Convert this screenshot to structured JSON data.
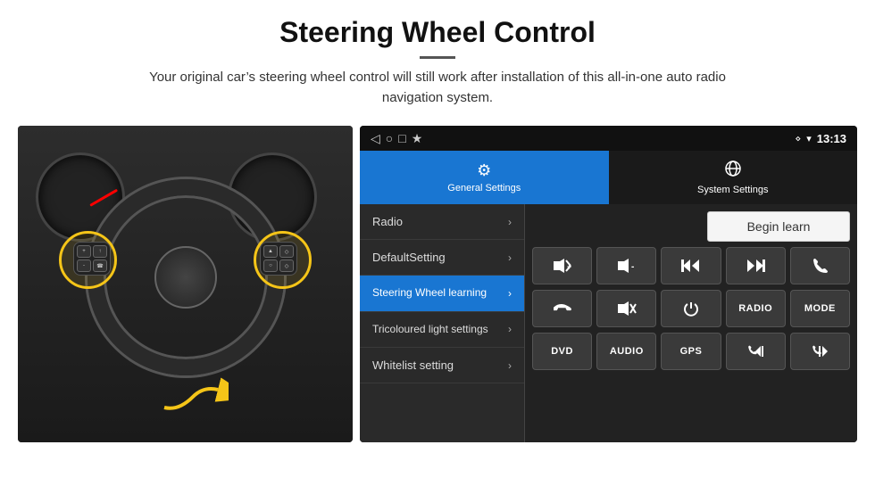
{
  "header": {
    "title": "Steering Wheel Control",
    "divider": true,
    "subtitle": "Your original car’s steering wheel control will still work after installation of this all-in-one auto radio navigation system."
  },
  "headunit": {
    "status_bar": {
      "nav_back": "◁",
      "nav_home": "○",
      "nav_recent": "□",
      "nav_cast": "★",
      "location_icon": "❖",
      "wifi_icon": "▾",
      "time": "13:13"
    },
    "tabs": [
      {
        "label": "General Settings",
        "active": true
      },
      {
        "label": "System Settings",
        "active": false
      }
    ],
    "menu_items": [
      {
        "label": "Radio",
        "active": false
      },
      {
        "label": "DefaultSetting",
        "active": false
      },
      {
        "label": "Steering Wheel learning",
        "active": true
      },
      {
        "label": "Tricoloured light settings",
        "active": false
      },
      {
        "label": "Whitelist setting",
        "active": false
      }
    ],
    "begin_learn_btn": "Begin learn",
    "control_buttons_row1": [
      {
        "label": "🔊+",
        "symbol": "vol-up"
      },
      {
        "label": "🔊-",
        "symbol": "vol-down"
      },
      {
        "label": "⧏⧏",
        "symbol": "prev-track"
      },
      {
        "label": "⧐⧐",
        "symbol": "next-track"
      },
      {
        "label": "✆",
        "symbol": "phone"
      }
    ],
    "control_buttons_row2": [
      {
        "label": "✆↓",
        "symbol": "hang-up"
      },
      {
        "label": "🔇×",
        "symbol": "mute"
      },
      {
        "label": "⏻",
        "symbol": "power"
      },
      {
        "label": "RADIO",
        "symbol": "radio",
        "text": true
      },
      {
        "label": "MODE",
        "symbol": "mode",
        "text": true
      }
    ],
    "control_buttons_row3": [
      {
        "label": "DVD",
        "symbol": "dvd",
        "text": true
      },
      {
        "label": "AUDIO",
        "symbol": "audio",
        "text": true
      },
      {
        "label": "GPS",
        "symbol": "gps",
        "text": true
      },
      {
        "label": "☎⧏⧏",
        "symbol": "phone-prev"
      },
      {
        "label": "☎⧐⧐",
        "symbol": "phone-next"
      }
    ]
  }
}
